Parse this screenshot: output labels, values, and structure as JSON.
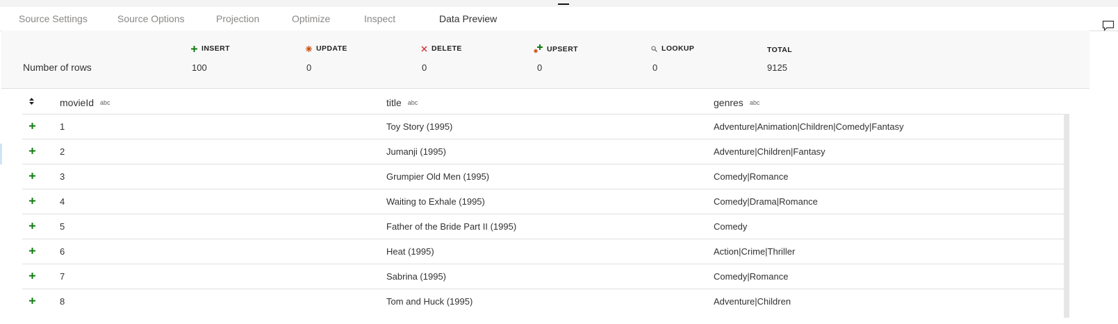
{
  "tabs": [
    {
      "label": "Source Settings",
      "active": false
    },
    {
      "label": "Source Options",
      "active": false
    },
    {
      "label": "Projection",
      "active": false
    },
    {
      "label": "Optimize",
      "active": false
    },
    {
      "label": "Inspect",
      "active": false
    },
    {
      "label": "Data Preview",
      "active": true
    }
  ],
  "summary": {
    "row_label": "Number of rows",
    "columns": [
      {
        "label": "INSERT",
        "icon": "insert-plus-icon",
        "value": "100"
      },
      {
        "label": "UPDATE",
        "icon": "update-asterisk-icon",
        "value": "0"
      },
      {
        "label": "DELETE",
        "icon": "delete-x-icon",
        "value": "0"
      },
      {
        "label": "UPSERT",
        "icon": "upsert-icon",
        "value": "0"
      },
      {
        "label": "LOOKUP",
        "icon": "lookup-magnifier-icon",
        "value": "0"
      },
      {
        "label": "TOTAL",
        "icon": "",
        "value": "9125"
      }
    ]
  },
  "table": {
    "type_badge": "abc",
    "headers": [
      "movieId",
      "title",
      "genres"
    ],
    "rows": [
      {
        "movieId": "1",
        "title": "Toy Story (1995)",
        "genres": "Adventure|Animation|Children|Comedy|Fantasy"
      },
      {
        "movieId": "2",
        "title": "Jumanji (1995)",
        "genres": "Adventure|Children|Fantasy"
      },
      {
        "movieId": "3",
        "title": "Grumpier Old Men (1995)",
        "genres": "Comedy|Romance"
      },
      {
        "movieId": "4",
        "title": "Waiting to Exhale (1995)",
        "genres": "Comedy|Drama|Romance"
      },
      {
        "movieId": "5",
        "title": "Father of the Bride Part II (1995)",
        "genres": "Comedy"
      },
      {
        "movieId": "6",
        "title": "Heat (1995)",
        "genres": "Action|Crime|Thriller"
      },
      {
        "movieId": "7",
        "title": "Sabrina (1995)",
        "genres": "Comedy|Romance"
      },
      {
        "movieId": "8",
        "title": "Tom and Huck (1995)",
        "genres": "Adventure|Children"
      }
    ]
  },
  "colors": {
    "accent": "#0078d4",
    "insert": "#107c10",
    "update": "#ca5010",
    "delete": "#d13438"
  }
}
